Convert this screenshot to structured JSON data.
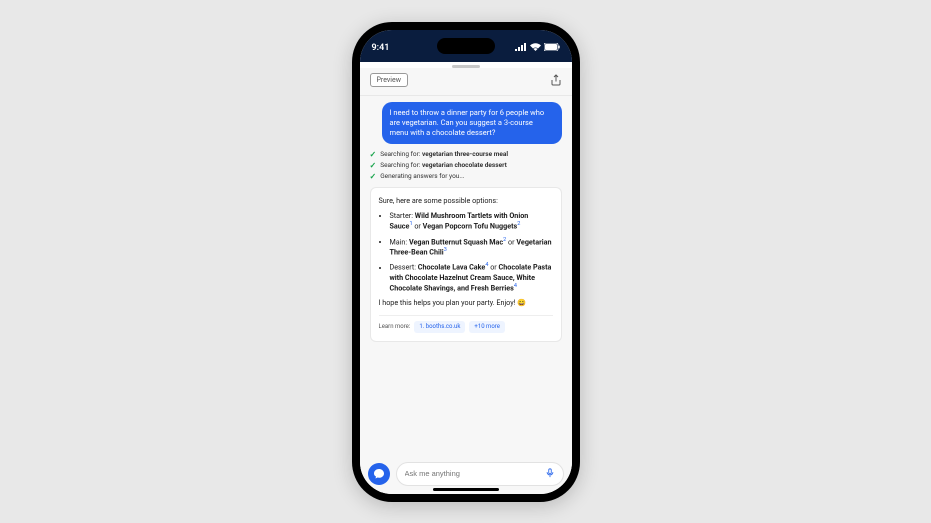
{
  "status_bar": {
    "time": "9:41"
  },
  "header": {
    "preview_badge": "Preview"
  },
  "chat": {
    "user_message": "I need to throw a dinner party for 6 people who are vegetarian. Can you suggest a 3-course menu with a chocolate dessert?",
    "status_lines": [
      {
        "prefix": "Searching for:",
        "query": "vegetarian three-course meal"
      },
      {
        "prefix": "Searching for:",
        "query": "vegetarian chocolate dessert"
      },
      {
        "prefix": "Generating answers for you...",
        "query": ""
      }
    ],
    "answer": {
      "intro": "Sure, here are some possible options:",
      "items": [
        {
          "label": "Starter:",
          "opt1": "Wild Mushroom Tartlets with Onion Sauce",
          "cite1": "1",
          "or": "or",
          "opt2": "Vegan Popcorn Tofu Nuggets",
          "cite2": "2"
        },
        {
          "label": "Main:",
          "opt1": "Vegan Butternut Squash Mac",
          "cite1": "2",
          "or": "or",
          "opt2": "Vegetarian Three-Bean Chili",
          "cite2": "3"
        },
        {
          "label": "Dessert:",
          "opt1": "Chocolate Lava Cake",
          "cite1": "4",
          "or": "or",
          "opt2": "Chocolate Pasta with Chocolate Hazelnut Cream Sauce, White Chocolate Shavings, and Fresh Berries",
          "cite2": "4"
        }
      ],
      "outro": "I hope this helps you plan your party. Enjoy! 😄"
    },
    "learn_more": {
      "label": "Learn more:",
      "links": [
        "1. booths.co.uk",
        "+10 more"
      ]
    }
  },
  "input": {
    "placeholder": "Ask me anything"
  }
}
